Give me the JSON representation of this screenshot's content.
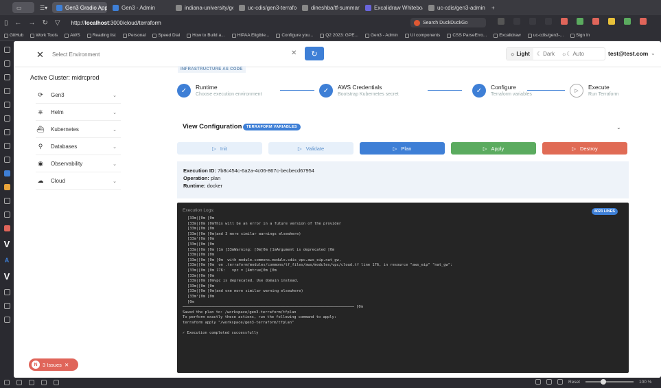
{
  "browser": {
    "tabs": [
      {
        "label": "Gen3 Gradio App",
        "color": "#3e7fd6",
        "active": true
      },
      {
        "label": "Gen3 - Admin",
        "color": "#3e7fd6",
        "active": false
      },
      {
        "label": "indiana-university/gen3-k",
        "color": "#888888",
        "active": false
      },
      {
        "label": "uc-cdis/gen3-terraform a",
        "color": "#888888",
        "active": false
      },
      {
        "label": "dineshba/tf-summarize: A",
        "color": "#888888",
        "active": false
      },
      {
        "label": "Excalidraw Whiteboard",
        "color": "#6965db",
        "active": false
      },
      {
        "label": "uc-cdis/gen3-admin at fe",
        "color": "#888888",
        "active": false
      }
    ],
    "new_tab": "+",
    "url_prefix": "http://",
    "url_host": "localhost",
    "url_path": ":3000/cloud/terraform",
    "search_placeholder": "Search DuckDuckGo",
    "bookmarks": [
      "GitHub",
      "Work Tools",
      "AWS",
      "Reading list",
      "Personal",
      "Speed Dial",
      "How to Build a...",
      "HIPAA Eligible...",
      "Configure you...",
      "Q2 2023: GPE...",
      "Gen3 - Admin",
      "UI components",
      "CSS ParseErro...",
      "Excalidraw",
      "uc-cdis/gen3-...",
      "Sign In"
    ]
  },
  "topbar": {
    "env_placeholder": "Select Environment",
    "theme": {
      "light": "Light",
      "dark": "Dark",
      "auto": "Auto"
    },
    "user": "test@test.com"
  },
  "sidebar": {
    "cluster_label": "Active Cluster: midrcprod",
    "items": [
      {
        "label": "Gen3",
        "icon": "gen3-icon"
      },
      {
        "label": "Helm",
        "icon": "helm-icon"
      },
      {
        "label": "Kubernetes",
        "icon": "kubernetes-icon"
      },
      {
        "label": "Databases",
        "icon": "search-icon"
      },
      {
        "label": "Observability",
        "icon": "eye-icon"
      },
      {
        "label": "Cloud",
        "icon": "cloud-icon"
      }
    ],
    "issues": {
      "count": "N",
      "label": "3 Issues"
    }
  },
  "main": {
    "section_badge": "INFRASTRUCTURE AS CODE",
    "steps": [
      {
        "title": "Runtime",
        "subtitle": "Choose execution environment",
        "done": true
      },
      {
        "title": "AWS Credentials",
        "subtitle": "Bootstrap Kubernetes secret",
        "done": true
      },
      {
        "title": "Configure",
        "subtitle": "Terraform variables",
        "done": true
      },
      {
        "title": "Execute",
        "subtitle": "Run Terraform",
        "done": false
      }
    ],
    "view_config": "View Configuration",
    "tf_badge": "TERRAFORM VARIABLES",
    "actions": {
      "init": "Init",
      "validate": "Validate",
      "plan": "Plan",
      "apply": "Apply",
      "destroy": "Destroy"
    },
    "execution": {
      "id_label": "Execution ID:",
      "id_value": "7b8c454c-6a2a-4c06-867c-becbecd67954",
      "op_label": "Operation:",
      "op_value": "plan",
      "runtime_label": "Runtime:",
      "runtime_value": "docker"
    },
    "log": {
      "title": "Execution Logs:",
      "lines_badge": "8023 LINES",
      "lines": [
        "[33m│[0m [0m",
        "[33m│[0m [0mThis will be an error in a future version of the provider",
        "[33m│[0m [0m",
        "[33m│[0m [0m(and 3 more similar warnings elsewhere)",
        "[33m╵[0m [0m",
        "[33m│[0m [0m",
        "[33m│[0m [0m [1m [33mWarning: [0m[0m [1mArgument is deprecated [0m",
        "[33m│[0m [0m",
        "[33m│[0m [0m [0m  with module.commons.module.cdis_vpc.aws_eip.nat_gw,",
        "[33m│[0m [0m  on .terraform/modules/commons/tf_files/aws/modules/vpc/cloud.tf line 176, in resource \"aws_eip\" \"nat_gw\":",
        "[33m│[0m [0m 176:   vpc = [4mtrue[0m [0m",
        "[33m│[0m [0m",
        "[33m│[0m [0mvpc is deprecated. Use domain instead.",
        "[33m│[0m [0m",
        "[33m│[0m [0m(and one more similar warning elsewhere)",
        "[33m╵[0m [0m",
        "[0m",
        "───────────────────────────────────────────────────────────────────────────── [0m",
        "Saved the plan to: /workspace/gen3-terraform/tfplan",
        "To perform exactly these actions, run the following command to apply:",
        "terraform apply \"/workspace/gen3-terraform/tfplan\"",
        "",
        "✓ Execution completed successfully"
      ]
    }
  },
  "statusbar": {
    "reset": "Reset",
    "zoom": "100 %",
    "zoom_fraction": 0.35
  }
}
